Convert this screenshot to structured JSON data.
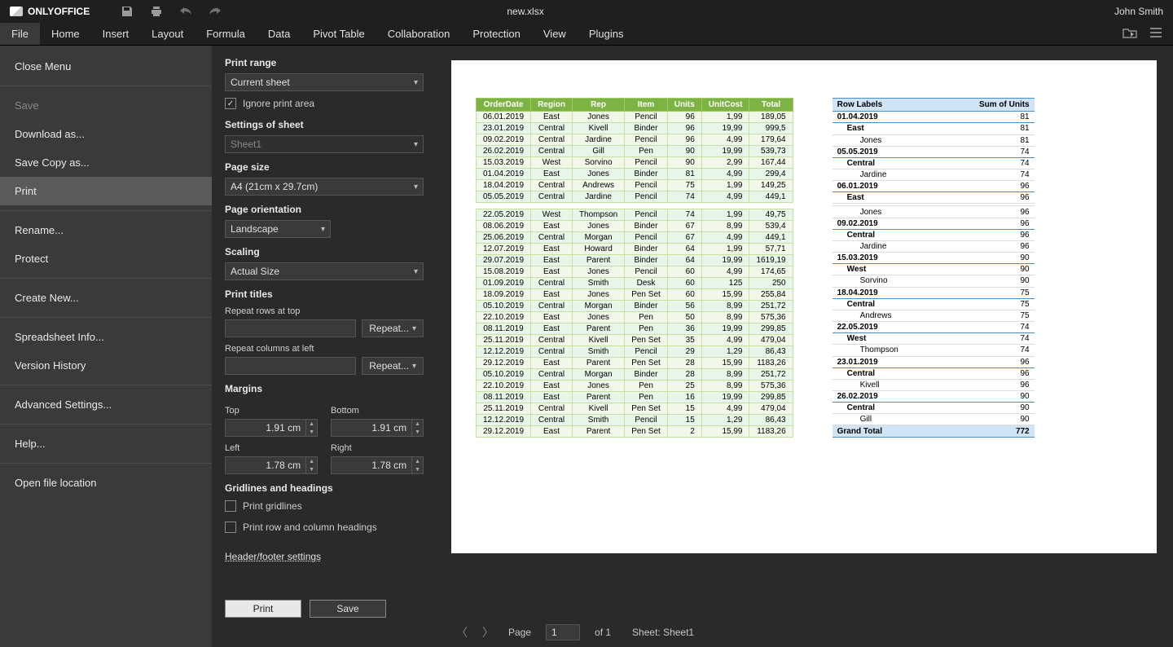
{
  "app": {
    "name": "ONLYOFFICE",
    "filename": "new.xlsx",
    "user": "John Smith"
  },
  "menutabs": [
    "File",
    "Home",
    "Insert",
    "Layout",
    "Formula",
    "Data",
    "Pivot Table",
    "Collaboration",
    "Protection",
    "View",
    "Plugins"
  ],
  "file_menu": {
    "close": "Close Menu",
    "items": [
      "Save",
      "Download as...",
      "Save Copy as...",
      "Print",
      "Rename...",
      "Protect",
      "Create New...",
      "Spreadsheet Info...",
      "Version History",
      "Advanced Settings...",
      "Help...",
      "Open file location"
    ]
  },
  "settings": {
    "print_range_lbl": "Print range",
    "print_range_val": "Current sheet",
    "ignore_lbl": "Ignore print area",
    "settings_sheet_lbl": "Settings of sheet",
    "sheet_val": "Sheet1",
    "page_size_lbl": "Page size",
    "page_size_val": "A4 (21cm x 29.7cm)",
    "page_orient_lbl": "Page orientation",
    "page_orient_val": "Landscape",
    "scaling_lbl": "Scaling",
    "scaling_val": "Actual Size",
    "print_titles_lbl": "Print titles",
    "repeat_rows_lbl": "Repeat rows at top",
    "repeat_cols_lbl": "Repeat columns at left",
    "repeat_btn": "Repeat...",
    "margins_lbl": "Margins",
    "top_lbl": "Top",
    "bottom_lbl": "Bottom",
    "left_lbl": "Left",
    "right_lbl": "Right",
    "top_val": "1.91 cm",
    "bottom_val": "1.91 cm",
    "left_val": "1.78 cm",
    "right_val": "1.78 cm",
    "grid_lbl": "Gridlines and headings",
    "grid_cb": "Print gridlines",
    "head_cb": "Print row and column headings",
    "hf_link": "Header/footer settings",
    "btn_print": "Print",
    "btn_save": "Save"
  },
  "footer": {
    "page_lbl": "Page",
    "page_val": "1",
    "of_lbl": "of 1",
    "sheet_lbl": "Sheet: Sheet1"
  },
  "table": {
    "headers": [
      "OrderDate",
      "Region",
      "Rep",
      "Item",
      "Units",
      "UnitCost",
      "Total"
    ],
    "rows1": [
      [
        "06.01.2019",
        "East",
        "Jones",
        "Pencil",
        "96",
        "1,99",
        "189,05"
      ],
      [
        "23.01.2019",
        "Central",
        "Kivell",
        "Binder",
        "96",
        "19,99",
        "999,5"
      ],
      [
        "09.02.2019",
        "Central",
        "Jardine",
        "Pencil",
        "96",
        "4,99",
        "179,64"
      ],
      [
        "26.02.2019",
        "Central",
        "Gill",
        "Pen",
        "90",
        "19,99",
        "539,73"
      ],
      [
        "15.03.2019",
        "West",
        "Sorvino",
        "Pencil",
        "90",
        "2,99",
        "167,44"
      ],
      [
        "01.04.2019",
        "East",
        "Jones",
        "Binder",
        "81",
        "4,99",
        "299,4"
      ],
      [
        "18.04.2019",
        "Central",
        "Andrews",
        "Pencil",
        "75",
        "1,99",
        "149,25"
      ],
      [
        "05.05.2019",
        "Central",
        "Jardine",
        "Pencil",
        "74",
        "4,99",
        "449,1"
      ]
    ],
    "rows2": [
      [
        "22.05.2019",
        "West",
        "Thompson",
        "Pencil",
        "74",
        "1,99",
        "49,75"
      ],
      [
        "08.06.2019",
        "East",
        "Jones",
        "Binder",
        "67",
        "8,99",
        "539,4"
      ],
      [
        "25.06.2019",
        "Central",
        "Morgan",
        "Pencil",
        "67",
        "4,99",
        "449,1"
      ],
      [
        "12.07.2019",
        "East",
        "Howard",
        "Binder",
        "64",
        "1,99",
        "57,71"
      ],
      [
        "29.07.2019",
        "East",
        "Parent",
        "Binder",
        "64",
        "19,99",
        "1619,19"
      ],
      [
        "15.08.2019",
        "East",
        "Jones",
        "Pencil",
        "60",
        "4,99",
        "174,65"
      ],
      [
        "01.09.2019",
        "Central",
        "Smith",
        "Desk",
        "60",
        "125",
        "250"
      ],
      [
        "18.09.2019",
        "East",
        "Jones",
        "Pen Set",
        "60",
        "15,99",
        "255,84"
      ],
      [
        "05.10.2019",
        "Central",
        "Morgan",
        "Binder",
        "56",
        "8,99",
        "251,72"
      ],
      [
        "22.10.2019",
        "East",
        "Jones",
        "Pen",
        "50",
        "8,99",
        "575,36"
      ],
      [
        "08.11.2019",
        "East",
        "Parent",
        "Pen",
        "36",
        "19,99",
        "299,85"
      ],
      [
        "25.11.2019",
        "Central",
        "Kivell",
        "Pen Set",
        "35",
        "4,99",
        "479,04"
      ],
      [
        "12.12.2019",
        "Central",
        "Smith",
        "Pencil",
        "29",
        "1,29",
        "86,43"
      ],
      [
        "29.12.2019",
        "East",
        "Parent",
        "Pen Set",
        "28",
        "15,99",
        "1183,26"
      ],
      [
        "05.10.2019",
        "Central",
        "Morgan",
        "Binder",
        "28",
        "8,99",
        "251,72"
      ],
      [
        "22.10.2019",
        "East",
        "Jones",
        "Pen",
        "25",
        "8,99",
        "575,36"
      ],
      [
        "08.11.2019",
        "East",
        "Parent",
        "Pen",
        "16",
        "19,99",
        "299,85"
      ],
      [
        "25.11.2019",
        "Central",
        "Kivell",
        "Pen Set",
        "15",
        "4,99",
        "479,04"
      ],
      [
        "12.12.2019",
        "Central",
        "Smith",
        "Pencil",
        "15",
        "1,29",
        "86,43"
      ],
      [
        "29.12.2019",
        "East",
        "Parent",
        "Pen Set",
        "2",
        "15,99",
        "1183,26"
      ]
    ]
  },
  "pivot": {
    "h1": "Row Labels",
    "h2": "Sum of Units",
    "rows": [
      {
        "lv": 0,
        "lbl": "01.04.2019",
        "v": "81"
      },
      {
        "lv": 1,
        "lbl": "East",
        "v": "81"
      },
      {
        "lv": 2,
        "lbl": "Jones",
        "v": "81"
      },
      {
        "lv": 0,
        "lbl": "05.05.2019",
        "v": "74"
      },
      {
        "lv": 1,
        "lbl": "Central",
        "v": "74"
      },
      {
        "lv": 2,
        "lbl": "Jardine",
        "v": "74"
      },
      {
        "lv": 0,
        "lbl": "06.01.2019",
        "v": "96"
      },
      {
        "lv": 1,
        "lbl": "East",
        "v": "96"
      },
      {
        "lv": 2,
        "lbl": "",
        "v": ""
      },
      {
        "lv": 2,
        "lbl": "Jones",
        "v": "96"
      },
      {
        "lv": 0,
        "lbl": "09.02.2019",
        "v": "96"
      },
      {
        "lv": 1,
        "lbl": "Central",
        "v": "96"
      },
      {
        "lv": 2,
        "lbl": "Jardine",
        "v": "96"
      },
      {
        "lv": 0,
        "lbl": "15.03.2019",
        "v": "90"
      },
      {
        "lv": 1,
        "lbl": "West",
        "v": "90"
      },
      {
        "lv": 2,
        "lbl": "Sorvino",
        "v": "90"
      },
      {
        "lv": 0,
        "lbl": "18.04.2019",
        "v": "75"
      },
      {
        "lv": 1,
        "lbl": "Central",
        "v": "75"
      },
      {
        "lv": 2,
        "lbl": "Andrews",
        "v": "75"
      },
      {
        "lv": 0,
        "lbl": "22.05.2019",
        "v": "74"
      },
      {
        "lv": 1,
        "lbl": "West",
        "v": "74"
      },
      {
        "lv": 2,
        "lbl": "Thompson",
        "v": "74"
      },
      {
        "lv": 0,
        "lbl": "23.01.2019",
        "v": "96"
      },
      {
        "lv": 1,
        "lbl": "Central",
        "v": "96"
      },
      {
        "lv": 2,
        "lbl": "Kivell",
        "v": "96"
      },
      {
        "lv": 0,
        "lbl": "26.02.2019",
        "v": "90"
      },
      {
        "lv": 1,
        "lbl": "Central",
        "v": "90"
      },
      {
        "lv": 2,
        "lbl": "Gill",
        "v": "90"
      }
    ],
    "total_lbl": "Grand Total",
    "total_v": "772"
  }
}
